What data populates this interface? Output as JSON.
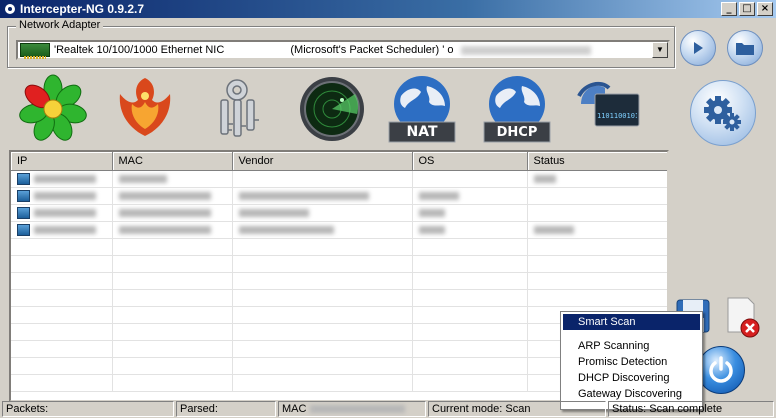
{
  "window": {
    "title": "Intercepter-NG 0.9.2.7"
  },
  "adapter": {
    "group_label": "Network Adapter",
    "selected_nic": "'Realtek 10/100/1000 Ethernet NIC",
    "selected_suffix": "(Microsoft's Packet Scheduler) ' o"
  },
  "toolbar": {
    "icons": [
      "icq-icon",
      "phoenix-icon",
      "keys-icon",
      "radar-icon",
      "nat-globe-icon",
      "dhcp-globe-icon",
      "network-card-icon"
    ],
    "nat_label": "NAT",
    "dhcp_label": "DHCP",
    "network_card_digits": "1101100101"
  },
  "table": {
    "columns": [
      "IP",
      "MAC",
      "Vendor",
      "OS",
      "Status"
    ],
    "rows_count_visible": 4
  },
  "context_menu": {
    "items": [
      "Smart Scan",
      "ARP Scanning",
      "Promisc Detection",
      "DHCP Discovering",
      "Gateway Discovering"
    ],
    "selected": "Smart Scan"
  },
  "status_bar": {
    "packets": "Packets:",
    "parsed": "Parsed:",
    "mac": "MAC",
    "mode": "Current mode: Scan",
    "status": "Status: Scan complete"
  },
  "colors": {
    "titlebar_start": "#0a246a",
    "menu_highlight": "#0a246a",
    "window_face": "#d4d0c8"
  }
}
